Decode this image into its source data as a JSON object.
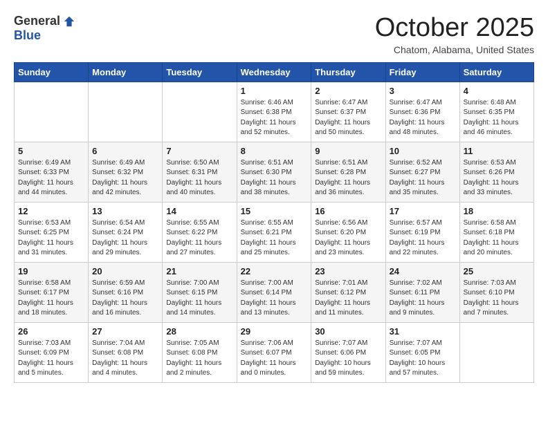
{
  "logo": {
    "general": "General",
    "blue": "Blue"
  },
  "title": "October 2025",
  "location": "Chatom, Alabama, United States",
  "days_header": [
    "Sunday",
    "Monday",
    "Tuesday",
    "Wednesday",
    "Thursday",
    "Friday",
    "Saturday"
  ],
  "weeks": [
    [
      {
        "day": "",
        "info": ""
      },
      {
        "day": "",
        "info": ""
      },
      {
        "day": "",
        "info": ""
      },
      {
        "day": "1",
        "info": "Sunrise: 6:46 AM\nSunset: 6:38 PM\nDaylight: 11 hours and 52 minutes."
      },
      {
        "day": "2",
        "info": "Sunrise: 6:47 AM\nSunset: 6:37 PM\nDaylight: 11 hours and 50 minutes."
      },
      {
        "day": "3",
        "info": "Sunrise: 6:47 AM\nSunset: 6:36 PM\nDaylight: 11 hours and 48 minutes."
      },
      {
        "day": "4",
        "info": "Sunrise: 6:48 AM\nSunset: 6:35 PM\nDaylight: 11 hours and 46 minutes."
      }
    ],
    [
      {
        "day": "5",
        "info": "Sunrise: 6:49 AM\nSunset: 6:33 PM\nDaylight: 11 hours and 44 minutes."
      },
      {
        "day": "6",
        "info": "Sunrise: 6:49 AM\nSunset: 6:32 PM\nDaylight: 11 hours and 42 minutes."
      },
      {
        "day": "7",
        "info": "Sunrise: 6:50 AM\nSunset: 6:31 PM\nDaylight: 11 hours and 40 minutes."
      },
      {
        "day": "8",
        "info": "Sunrise: 6:51 AM\nSunset: 6:30 PM\nDaylight: 11 hours and 38 minutes."
      },
      {
        "day": "9",
        "info": "Sunrise: 6:51 AM\nSunset: 6:28 PM\nDaylight: 11 hours and 36 minutes."
      },
      {
        "day": "10",
        "info": "Sunrise: 6:52 AM\nSunset: 6:27 PM\nDaylight: 11 hours and 35 minutes."
      },
      {
        "day": "11",
        "info": "Sunrise: 6:53 AM\nSunset: 6:26 PM\nDaylight: 11 hours and 33 minutes."
      }
    ],
    [
      {
        "day": "12",
        "info": "Sunrise: 6:53 AM\nSunset: 6:25 PM\nDaylight: 11 hours and 31 minutes."
      },
      {
        "day": "13",
        "info": "Sunrise: 6:54 AM\nSunset: 6:24 PM\nDaylight: 11 hours and 29 minutes."
      },
      {
        "day": "14",
        "info": "Sunrise: 6:55 AM\nSunset: 6:22 PM\nDaylight: 11 hours and 27 minutes."
      },
      {
        "day": "15",
        "info": "Sunrise: 6:55 AM\nSunset: 6:21 PM\nDaylight: 11 hours and 25 minutes."
      },
      {
        "day": "16",
        "info": "Sunrise: 6:56 AM\nSunset: 6:20 PM\nDaylight: 11 hours and 23 minutes."
      },
      {
        "day": "17",
        "info": "Sunrise: 6:57 AM\nSunset: 6:19 PM\nDaylight: 11 hours and 22 minutes."
      },
      {
        "day": "18",
        "info": "Sunrise: 6:58 AM\nSunset: 6:18 PM\nDaylight: 11 hours and 20 minutes."
      }
    ],
    [
      {
        "day": "19",
        "info": "Sunrise: 6:58 AM\nSunset: 6:17 PM\nDaylight: 11 hours and 18 minutes."
      },
      {
        "day": "20",
        "info": "Sunrise: 6:59 AM\nSunset: 6:16 PM\nDaylight: 11 hours and 16 minutes."
      },
      {
        "day": "21",
        "info": "Sunrise: 7:00 AM\nSunset: 6:15 PM\nDaylight: 11 hours and 14 minutes."
      },
      {
        "day": "22",
        "info": "Sunrise: 7:00 AM\nSunset: 6:14 PM\nDaylight: 11 hours and 13 minutes."
      },
      {
        "day": "23",
        "info": "Sunrise: 7:01 AM\nSunset: 6:12 PM\nDaylight: 11 hours and 11 minutes."
      },
      {
        "day": "24",
        "info": "Sunrise: 7:02 AM\nSunset: 6:11 PM\nDaylight: 11 hours and 9 minutes."
      },
      {
        "day": "25",
        "info": "Sunrise: 7:03 AM\nSunset: 6:10 PM\nDaylight: 11 hours and 7 minutes."
      }
    ],
    [
      {
        "day": "26",
        "info": "Sunrise: 7:03 AM\nSunset: 6:09 PM\nDaylight: 11 hours and 5 minutes."
      },
      {
        "day": "27",
        "info": "Sunrise: 7:04 AM\nSunset: 6:08 PM\nDaylight: 11 hours and 4 minutes."
      },
      {
        "day": "28",
        "info": "Sunrise: 7:05 AM\nSunset: 6:08 PM\nDaylight: 11 hours and 2 minutes."
      },
      {
        "day": "29",
        "info": "Sunrise: 7:06 AM\nSunset: 6:07 PM\nDaylight: 11 hours and 0 minutes."
      },
      {
        "day": "30",
        "info": "Sunrise: 7:07 AM\nSunset: 6:06 PM\nDaylight: 10 hours and 59 minutes."
      },
      {
        "day": "31",
        "info": "Sunrise: 7:07 AM\nSunset: 6:05 PM\nDaylight: 10 hours and 57 minutes."
      },
      {
        "day": "",
        "info": ""
      }
    ]
  ]
}
